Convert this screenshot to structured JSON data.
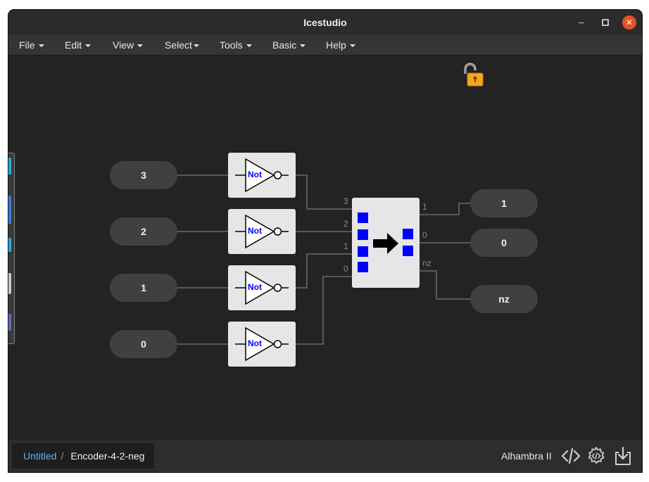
{
  "window": {
    "title": "Icestudio"
  },
  "window_controls": {
    "minimize": "–",
    "maximize": "□",
    "close": "✕"
  },
  "menubar": {
    "items": [
      {
        "label": "File"
      },
      {
        "label": "Edit"
      },
      {
        "label": "View"
      },
      {
        "label": "Select"
      },
      {
        "label": "Tools"
      },
      {
        "label": "Basic"
      },
      {
        "label": "Help"
      }
    ]
  },
  "canvas": {
    "lock_icon": "unlocked-padlock-icon",
    "inputs": [
      {
        "label": "3"
      },
      {
        "label": "2"
      },
      {
        "label": "1"
      },
      {
        "label": "0"
      }
    ],
    "not_gates": [
      {
        "label": "Not"
      },
      {
        "label": "Not"
      },
      {
        "label": "Not"
      },
      {
        "label": "Not"
      }
    ],
    "encoder": {
      "input_ports": [
        "3",
        "2",
        "1",
        "0"
      ],
      "output_ports": [
        "1",
        "0",
        "nz"
      ],
      "icon": "right-arrow-icon",
      "port_color": "#0000ff"
    },
    "outputs": [
      {
        "label": "1"
      },
      {
        "label": "0"
      },
      {
        "label": "nz"
      }
    ]
  },
  "footer": {
    "breadcrumb": {
      "root": "Untitled",
      "separator": "/",
      "current": "Encoder-4-2-neg"
    },
    "board": "Alhambra II",
    "icons": [
      "code-icon",
      "settings-code-icon",
      "download-icon"
    ]
  },
  "colors": {
    "canvas_bg": "#232323",
    "block_bg": "#e6e6e6",
    "pill_bg": "#404040",
    "wire": "#777777",
    "link": "#5fb2e8",
    "close_button": "#e25424",
    "lock": "#f5a623"
  }
}
